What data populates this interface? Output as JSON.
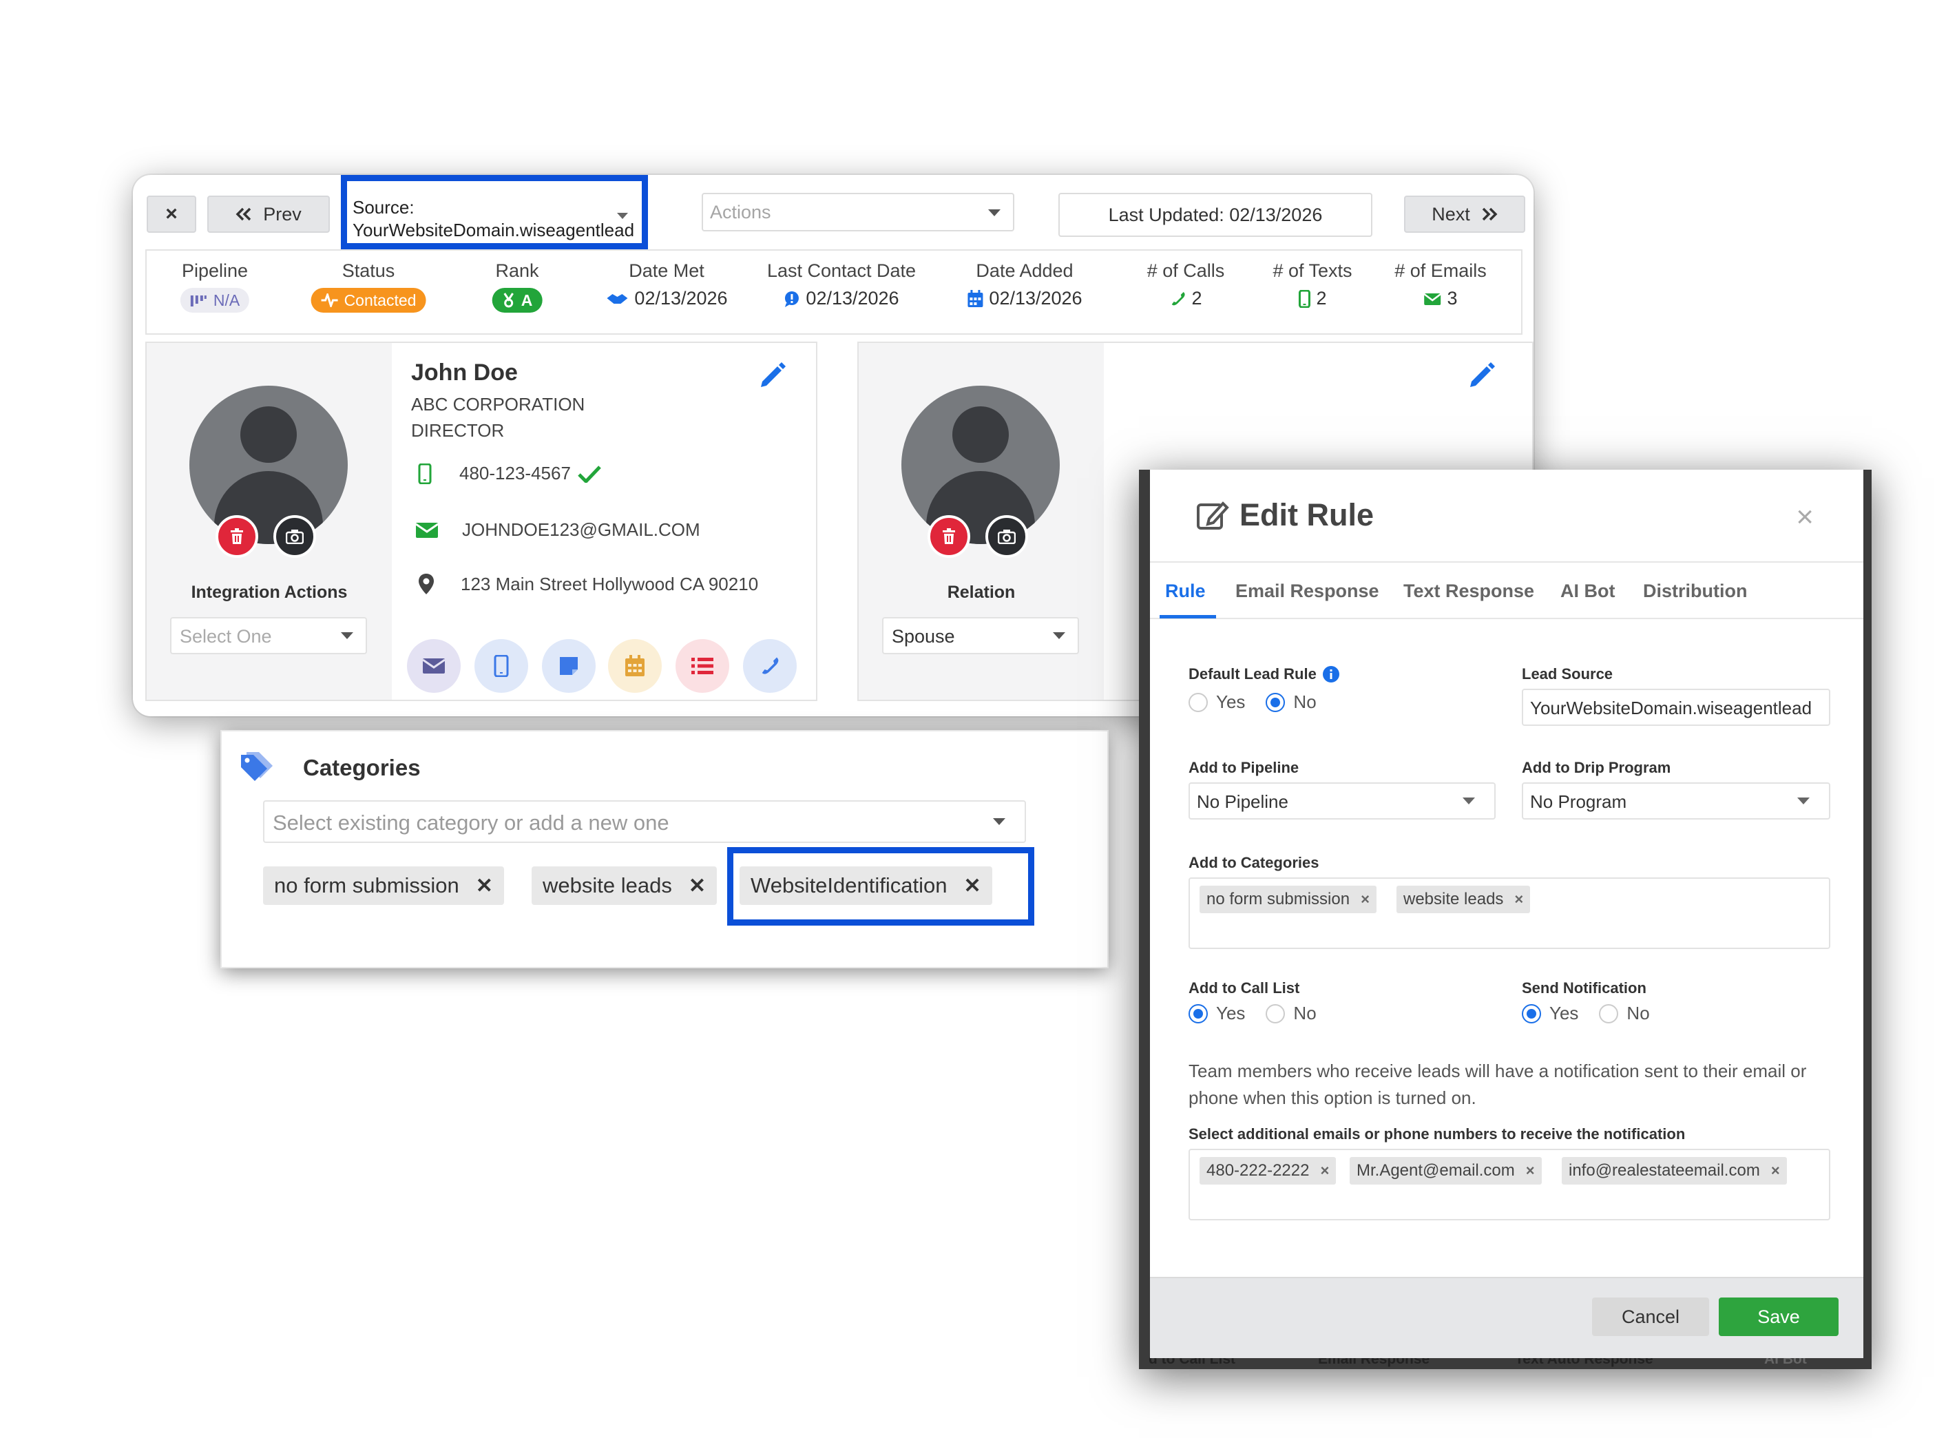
{
  "toolbar": {
    "close_label": "×",
    "prev_label": "Prev",
    "source_line1": "Source:",
    "source_line2": "YourWebsiteDomain.wiseagentlead",
    "actions_placeholder": "Actions",
    "last_updated": "Last Updated: 02/13/2026",
    "next_label": "Next"
  },
  "stats": {
    "pipeline": {
      "label": "Pipeline",
      "value": "N/A"
    },
    "status": {
      "label": "Status",
      "value": "Contacted"
    },
    "rank": {
      "label": "Rank",
      "value": "A"
    },
    "date_met": {
      "label": "Date Met",
      "value": "02/13/2026"
    },
    "last_contact": {
      "label": "Last Contact Date",
      "value": "02/13/2026"
    },
    "date_added": {
      "label": "Date Added",
      "value": "02/13/2026"
    },
    "calls": {
      "label": "# of Calls",
      "value": "2"
    },
    "texts": {
      "label": "# of Texts",
      "value": "2"
    },
    "emails": {
      "label": "# of Emails",
      "value": "3"
    }
  },
  "contact": {
    "name": "John Doe",
    "company": "ABC CORPORATION",
    "title": "DIRECTOR",
    "phone": "480-123-4567",
    "email": "JOHNDOE123@GMAIL.COM",
    "address": "123 Main Street Hollywood CA 90210",
    "integration_label": "Integration Actions",
    "integration_placeholder": "Select One"
  },
  "relation": {
    "label": "Relation",
    "value": "Spouse"
  },
  "categories": {
    "heading": "Categories",
    "placeholder": "Select existing category or add a new one",
    "tags": [
      "no form submission",
      "website leads",
      "WebsiteIdentification"
    ],
    "remove_glyph": "✕"
  },
  "modal": {
    "title": "Edit Rule",
    "close_glyph": "×",
    "tabs": [
      "Rule",
      "Email Response",
      "Text Response",
      "AI Bot",
      "Distribution"
    ],
    "default_lead_rule": {
      "label": "Default Lead Rule",
      "options": [
        "Yes",
        "No"
      ],
      "selected": "No"
    },
    "lead_source": {
      "label": "Lead Source",
      "value": "YourWebsiteDomain.wiseagentlead"
    },
    "pipeline": {
      "label": "Add to Pipeline",
      "value": "No Pipeline"
    },
    "drip": {
      "label": "Add to Drip Program",
      "value": "No Program"
    },
    "categories": {
      "label": "Add to Categories",
      "tags": [
        "no form submission",
        "website leads"
      ]
    },
    "call_list": {
      "label": "Add to Call List",
      "options": [
        "Yes",
        "No"
      ],
      "selected": "Yes"
    },
    "notification": {
      "label": "Send Notification",
      "options": [
        "Yes",
        "No"
      ],
      "selected": "Yes"
    },
    "notify_help": "Team members who receive leads will have a notification sent to their email or phone when this option is turned on.",
    "recipients": {
      "label": "Select additional emails or phone numbers to receive the notification",
      "tags": [
        "480-222-2222",
        "Mr.Agent@email.com",
        "info@realestateemail.com"
      ]
    },
    "cancel_label": "Cancel",
    "save_label": "Save",
    "tag_remove": "×",
    "background_headers": [
      "d to Call List",
      "Email Response",
      "Text Auto Response",
      "AI Bot"
    ]
  },
  "colors": {
    "highlight": "#0b4fd8",
    "status_orange": "#f7941d",
    "rank_green": "#22a53a",
    "link_blue": "#1a6fe8",
    "save_green": "#2ea43e",
    "delete_red": "#e0263a"
  },
  "icons": [
    "close-icon",
    "chevron-double-left-icon",
    "chevron-double-right-icon",
    "pipeline-icon",
    "pulse-icon",
    "rank-icon",
    "handshake-icon",
    "chat-icon",
    "calendar-icon",
    "phone-icon",
    "mobile-icon",
    "envelope-icon",
    "pencil-icon",
    "trash-icon",
    "camera-icon",
    "check-icon",
    "map-pin-icon",
    "note-icon",
    "list-icon",
    "tags-icon",
    "info-icon",
    "edit-icon"
  ]
}
